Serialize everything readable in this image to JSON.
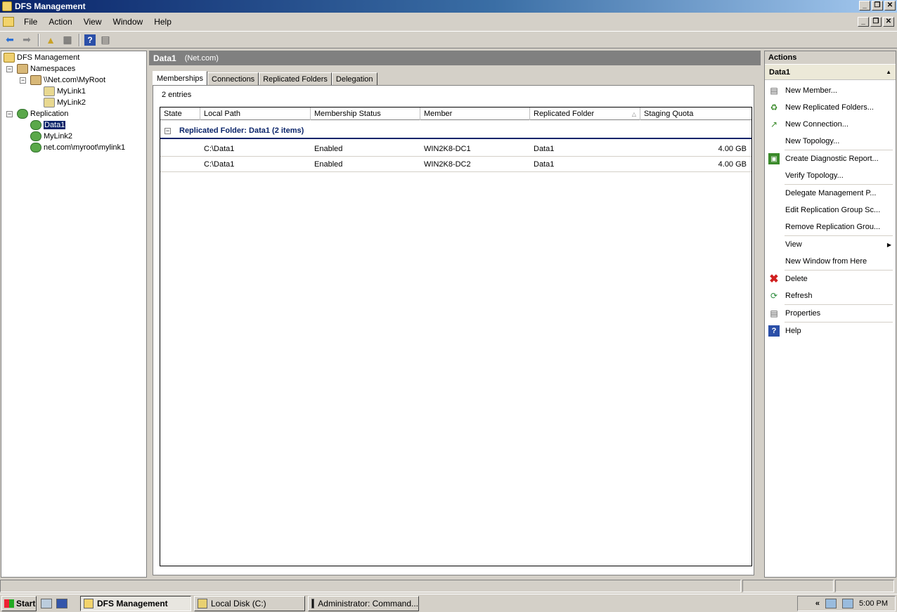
{
  "window": {
    "title": "DFS Management"
  },
  "menu": [
    "File",
    "Action",
    "View",
    "Window",
    "Help"
  ],
  "tree": {
    "root": "DFS Management",
    "namespaces": "Namespaces",
    "namespace_root": "\\\\Net.com\\MyRoot",
    "links": [
      "MyLink1",
      "MyLink2"
    ],
    "replication": "Replication",
    "groups": [
      "Data1",
      "MyLink2",
      "net.com\\myroot\\mylink1"
    ]
  },
  "center": {
    "title": "Data1",
    "subtitle": "(Net.com)",
    "tabs": [
      "Memberships",
      "Connections",
      "Replicated Folders",
      "Delegation"
    ],
    "entries": "2 entries",
    "columns": [
      "State",
      "Local Path",
      "Membership Status",
      "Member",
      "Replicated Folder",
      "Staging Quota"
    ],
    "group_label": "Replicated Folder: Data1 (2 items)",
    "rows": [
      {
        "state": "",
        "local_path": "C:\\Data1",
        "status": "Enabled",
        "member": "WIN2K8-DC1",
        "folder": "Data1",
        "quota": "4.00 GB"
      },
      {
        "state": "",
        "local_path": "C:\\Data1",
        "status": "Enabled",
        "member": "WIN2K8-DC2",
        "folder": "Data1",
        "quota": "4.00 GB"
      }
    ]
  },
  "actions": {
    "header": "Actions",
    "section": "Data1",
    "items": [
      "New Member...",
      "New Replicated Folders...",
      "New Connection...",
      "New Topology...",
      "Create Diagnostic Report...",
      "Verify Topology...",
      "Delegate Management P...",
      "Edit Replication Group Sc...",
      "Remove Replication Grou...",
      "View",
      "New Window from Here",
      "Delete",
      "Refresh",
      "Properties",
      "Help"
    ]
  },
  "taskbar": {
    "start": "Start",
    "tasks": [
      "DFS Management",
      "Local Disk (C:)",
      "Administrator: Command..."
    ],
    "clock": "5:00 PM",
    "tray_chevron": "«"
  }
}
